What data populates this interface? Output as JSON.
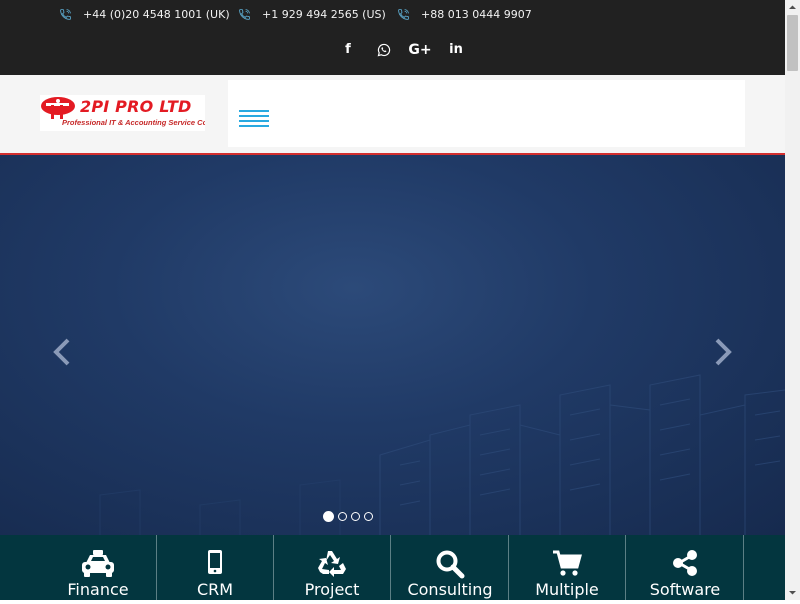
{
  "topbar": {
    "phones": [
      {
        "number": "+44 (0)20 4548 1001 (UK)"
      },
      {
        "number": "+1 929 494 2565 (US)"
      },
      {
        "number": "+88 013 0444 9907"
      }
    ],
    "socials": [
      {
        "name": "facebook",
        "glyph": "f"
      },
      {
        "name": "whatsapp",
        "glyph": ""
      },
      {
        "name": "google-plus",
        "glyph": "G+"
      },
      {
        "name": "linkedin",
        "glyph": "in"
      }
    ]
  },
  "header": {
    "logo": {
      "brand": "2PI PRO LTD",
      "tagline": "Professional IT & Accounting Service Company"
    }
  },
  "hero": {
    "slides_total": 4,
    "active_slide": 1
  },
  "services": [
    {
      "label": "Finance",
      "icon": "taxi-icon"
    },
    {
      "label": "CRM",
      "icon": "mobile-icon"
    },
    {
      "label": "Project",
      "icon": "recycle-icon"
    },
    {
      "label": "Consulting",
      "icon": "search-icon"
    },
    {
      "label": "Multiple",
      "icon": "cart-icon"
    },
    {
      "label": "Software",
      "icon": "share-icon"
    }
  ],
  "colors": {
    "topbar_bg": "#212121",
    "header_bg": "#f5f5f5",
    "accent_red": "#d32f2f",
    "hamburger": "#29a9e0",
    "hero_bg": "#203a66",
    "services_bg": "#03363f"
  }
}
